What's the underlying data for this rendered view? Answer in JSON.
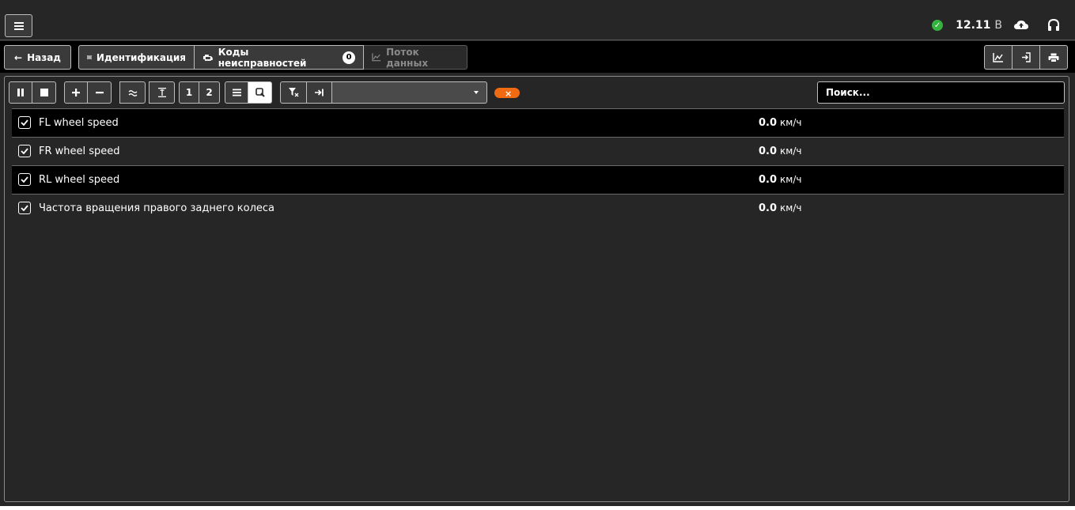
{
  "status": {
    "voltage": "12.11",
    "voltage_unit": "В",
    "ok_color": "#35b33f"
  },
  "nav": {
    "back_label": "Назад",
    "tabs": [
      {
        "label": "Идентификация",
        "icon": "list-icon"
      },
      {
        "label": "Коды неисправностей",
        "icon": "engine-icon",
        "badge": "0"
      },
      {
        "label": "Поток данных",
        "icon": "chart-line-icon",
        "disabled": true
      }
    ],
    "right_icons": [
      "chart-icon",
      "export-icon",
      "print-icon"
    ]
  },
  "toolbar": {
    "page_buttons": [
      "1",
      "2"
    ],
    "search_placeholder": "Поиск...",
    "accent_color": "#f06a12"
  },
  "rows": [
    {
      "label": "FL wheel speed",
      "value": "0.0",
      "unit": "км/ч",
      "checked": true
    },
    {
      "label": "FR wheel speed",
      "value": "0.0",
      "unit": "км/ч",
      "checked": true
    },
    {
      "label": "RL wheel speed",
      "value": "0.0",
      "unit": "км/ч",
      "checked": true
    },
    {
      "label": "Частота вращения правого заднего колеса",
      "value": "0.0",
      "unit": "км/ч",
      "checked": true
    }
  ]
}
